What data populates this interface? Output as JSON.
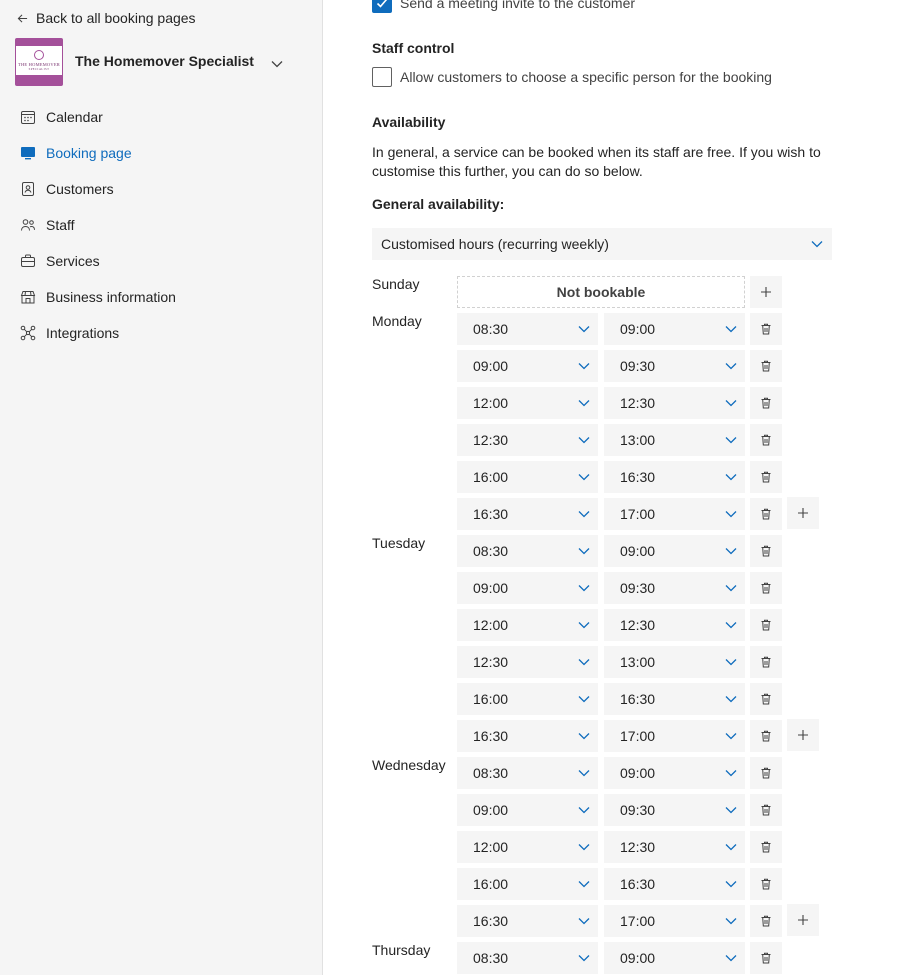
{
  "sidebar": {
    "back_label": "Back to all booking pages",
    "business_name": "The Homemover Specialist",
    "logo_line1": "THE HOMEMOVER",
    "logo_line2": "SPECIALIST",
    "nav": [
      {
        "label": "Calendar",
        "icon": "calendar-icon",
        "active": false
      },
      {
        "label": "Booking page",
        "icon": "monitor-icon",
        "active": true
      },
      {
        "label": "Customers",
        "icon": "contact-card-icon",
        "active": false
      },
      {
        "label": "Staff",
        "icon": "people-icon",
        "active": false
      },
      {
        "label": "Services",
        "icon": "briefcase-icon",
        "active": false
      },
      {
        "label": "Business information",
        "icon": "storefront-icon",
        "active": false
      },
      {
        "label": "Integrations",
        "icon": "connector-icon",
        "active": false
      }
    ]
  },
  "main": {
    "invite_label": "Send a meeting invite to the customer",
    "invite_checked": true,
    "staff_control_title": "Staff control",
    "staff_control_label": "Allow customers to choose a specific person for the booking",
    "staff_control_checked": false,
    "availability_title": "Availability",
    "availability_desc": "In general, a service can be booked when its staff are free. If you wish to customise this further, you can do so below.",
    "general_availability_label": "General availability:",
    "general_availability_value": "Customised hours (recurring weekly)",
    "not_bookable_label": "Not bookable",
    "days": [
      {
        "name": "Sunday",
        "slots": []
      },
      {
        "name": "Monday",
        "slots": [
          [
            "08:30",
            "09:00"
          ],
          [
            "09:00",
            "09:30"
          ],
          [
            "12:00",
            "12:30"
          ],
          [
            "12:30",
            "13:00"
          ],
          [
            "16:00",
            "16:30"
          ],
          [
            "16:30",
            "17:00"
          ]
        ]
      },
      {
        "name": "Tuesday",
        "slots": [
          [
            "08:30",
            "09:00"
          ],
          [
            "09:00",
            "09:30"
          ],
          [
            "12:00",
            "12:30"
          ],
          [
            "12:30",
            "13:00"
          ],
          [
            "16:00",
            "16:30"
          ],
          [
            "16:30",
            "17:00"
          ]
        ]
      },
      {
        "name": "Wednesday",
        "slots": [
          [
            "08:30",
            "09:00"
          ],
          [
            "09:00",
            "09:30"
          ],
          [
            "12:00",
            "12:30"
          ],
          [
            "16:00",
            "16:30"
          ],
          [
            "16:30",
            "17:00"
          ]
        ]
      },
      {
        "name": "Thursday",
        "slots": [
          [
            "08:30",
            "09:00"
          ]
        ]
      }
    ]
  },
  "colors": {
    "accent": "#0f6cbd",
    "logo": "#a4509a",
    "sidebar_bg": "#f5f5f5",
    "field_bg": "#f5f5f5"
  }
}
